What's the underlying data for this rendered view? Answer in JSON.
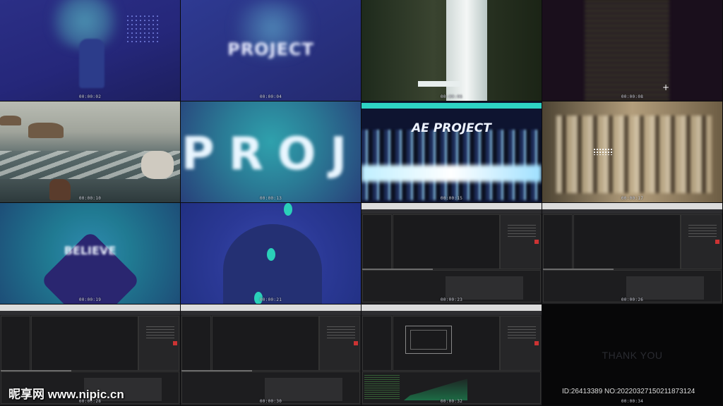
{
  "frames": [
    {
      "timecode": "00:00:02"
    },
    {
      "timecode": "00:00:04",
      "title": "PROJECT"
    },
    {
      "timecode": "00:00:06"
    },
    {
      "timecode": "00:00:08"
    },
    {
      "timecode": "00:00:10"
    },
    {
      "timecode": "00:00:13",
      "title": "PROJ"
    },
    {
      "timecode": "00:00:15",
      "title": "AE PROJECT"
    },
    {
      "timecode": "00:00:17"
    },
    {
      "timecode": "00:00:19",
      "title": "BELIEVE"
    },
    {
      "timecode": "00:00:21"
    },
    {
      "timecode": "00:00:23"
    },
    {
      "timecode": "00:00:26"
    },
    {
      "timecode": "00:00:28"
    },
    {
      "timecode": "00:00:30"
    },
    {
      "timecode": "00:00:32"
    },
    {
      "timecode": "00:00:34",
      "title": "THANK YOU"
    }
  ],
  "watermark": "昵享网 www.nipic.cn",
  "image_id": "ID:26413389 NO:20220327150211873124",
  "colors": {
    "background": "#0a0a0c",
    "teal": "#2ed3c4",
    "navy": "#2b2f86"
  }
}
